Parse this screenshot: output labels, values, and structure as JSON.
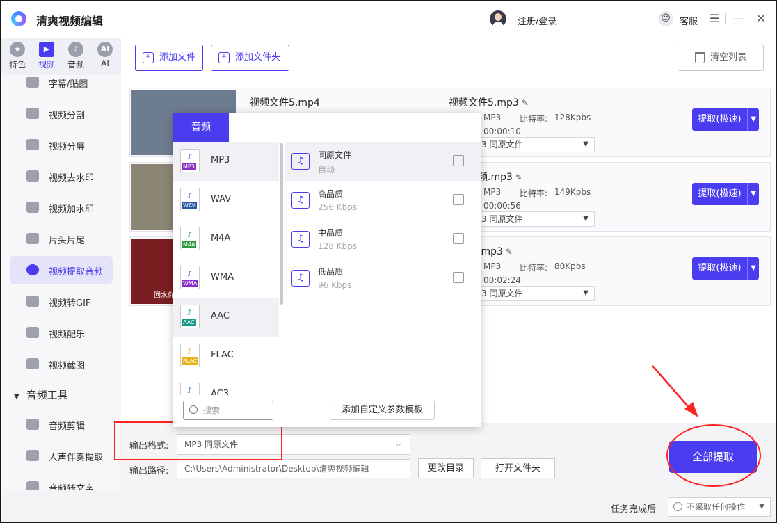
{
  "app": {
    "title": "清爽视频编辑",
    "login": "注册/登录",
    "service": "客服"
  },
  "window": {
    "menu": "☰",
    "minimize": "—",
    "close": "✕"
  },
  "categories": [
    {
      "label": "特色",
      "icon": "star-icon",
      "glyph": "★"
    },
    {
      "label": "视频",
      "icon": "film-icon",
      "glyph": "▶"
    },
    {
      "label": "音频",
      "icon": "music-icon",
      "glyph": "♪"
    },
    {
      "label": "AI",
      "icon": "ai-icon",
      "glyph": "AI"
    }
  ],
  "sidebar": {
    "items": [
      {
        "label": "字幕/贴图",
        "icon": "subtitle-icon"
      },
      {
        "label": "视频分割",
        "icon": "split-icon"
      },
      {
        "label": "视频分屏",
        "icon": "splitscreen-icon"
      },
      {
        "label": "视频去水印",
        "icon": "remove-watermark-icon"
      },
      {
        "label": "视频加水印",
        "icon": "add-watermark-icon"
      },
      {
        "label": "片头片尾",
        "icon": "intro-outro-icon"
      },
      {
        "label": "视频提取音频",
        "icon": "extract-audio-icon"
      },
      {
        "label": "视频转GIF",
        "icon": "gif-icon"
      },
      {
        "label": "视频配乐",
        "icon": "soundtrack-icon"
      },
      {
        "label": "视频截图",
        "icon": "screenshot-icon"
      }
    ],
    "section2": "音频工具",
    "items2": [
      {
        "label": "音频剪辑",
        "icon": "audio-cut-icon"
      },
      {
        "label": "人声伴奏提取",
        "icon": "vocal-icon"
      },
      {
        "label": "音频转文字",
        "icon": "speech-text-icon"
      }
    ]
  },
  "toolbar": {
    "add_file": "添加文件",
    "add_folder": "添加文件夹",
    "clear": "清空列表"
  },
  "files": [
    {
      "name": "视频文件5.mp4",
      "output": "视频文件5.mp3",
      "format": "MP3",
      "bitrate_label": "比特率:",
      "bitrate": "128Kpbs",
      "duration": "00:00:10",
      "sel": "3  同原文件",
      "extract": "提取(极速)",
      "thumb": "#6e7c90"
    },
    {
      "name": "",
      "output": "忐短视频.mp3",
      "format": "MP3",
      "bitrate_label": "比特率:",
      "bitrate": "149Kpbs",
      "duration": "00:00:56",
      "sel": "3  同原文件",
      "extract": "提取(极速)",
      "thumb": "#8a8574"
    },
    {
      "name": "",
      "output": "典片段.mp3",
      "format": "MP3",
      "bitrate_label": "比特率:",
      "bitrate": "80Kpbs",
      "duration": "00:02:24",
      "sel": "3  同原文件",
      "extract": "提取(极速)",
      "thumb": "#7a1e22",
      "caption": "回水你"
    }
  ],
  "popup": {
    "tab": "音频",
    "formats": [
      {
        "label": "MP3",
        "color": "#8b2fc9"
      },
      {
        "label": "WAV",
        "color": "#2a5aa6"
      },
      {
        "label": "M4A",
        "color": "#2a9a3c"
      },
      {
        "label": "WMA",
        "color": "#8b2fc9"
      },
      {
        "label": "AAC",
        "color": "#1a9a8a"
      },
      {
        "label": "FLAC",
        "color": "#e6b11a"
      },
      {
        "label": "AC3",
        "color": "#3a6ad6"
      }
    ],
    "qualities": [
      {
        "name": "同原文件",
        "sub": "自动"
      },
      {
        "name": "高品质",
        "sub": "256 Kbps"
      },
      {
        "name": "中品质",
        "sub": "128 Kbps"
      },
      {
        "name": "低品质",
        "sub": "96 Kbps"
      }
    ],
    "search_placeholder": "搜索",
    "add_template": "添加自定义参数模板"
  },
  "bottom": {
    "format_label": "输出格式:",
    "format_value": "MP3  同原文件",
    "path_label": "输出路径:",
    "path_value": "C:\\Users\\Administrator\\Desktop\\清爽视频编辑",
    "change_dir": "更改目录",
    "open_folder": "打开文件夹",
    "extract_all": "全部提取"
  },
  "status": {
    "after_label": "任务完成后",
    "after_value": "不采取任何操作"
  },
  "colors": {
    "accent": "#4a3df0",
    "annotation": "#ff2222"
  }
}
